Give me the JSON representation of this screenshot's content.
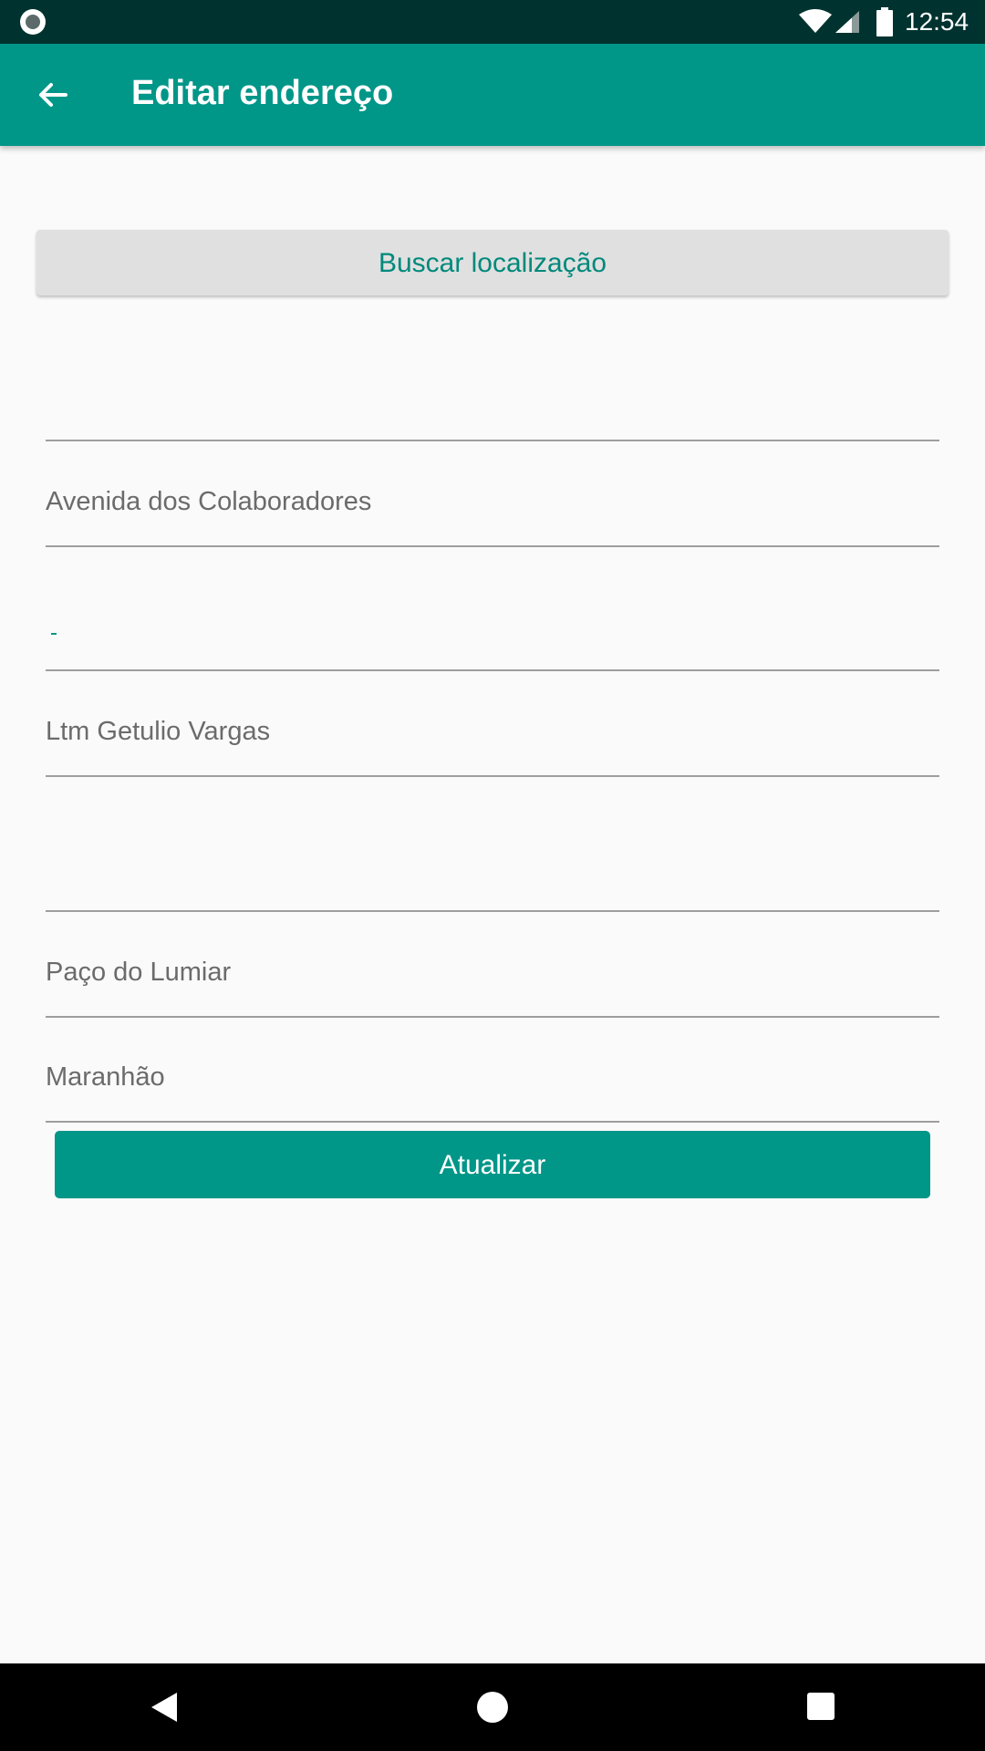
{
  "status_bar": {
    "time": "12:54",
    "icons": [
      "notification-circle-icon",
      "wifi-icon",
      "signal-icon",
      "battery-icon"
    ]
  },
  "app_bar": {
    "title": "Editar endereço",
    "back_icon": "arrow-left-icon",
    "background_color": "#009688"
  },
  "search_location": {
    "label": "Buscar localização"
  },
  "fields": [
    {
      "value": ""
    },
    {
      "value": "Avenida dos Colaboradores"
    },
    {
      "value": ""
    },
    {
      "value": "Ltm Getulio Vargas"
    },
    {
      "value": ""
    },
    {
      "value": "Paço do Lumiar"
    },
    {
      "value": "Maranhão"
    }
  ],
  "update_button": {
    "label": "Atualizar",
    "color": "#009688"
  },
  "nav_bar": {
    "icons": [
      "nav-back-icon",
      "nav-home-icon",
      "nav-recents-icon"
    ]
  },
  "colors": {
    "accent": "#009688",
    "status_bar": "#00332f",
    "background": "#fafafa"
  }
}
